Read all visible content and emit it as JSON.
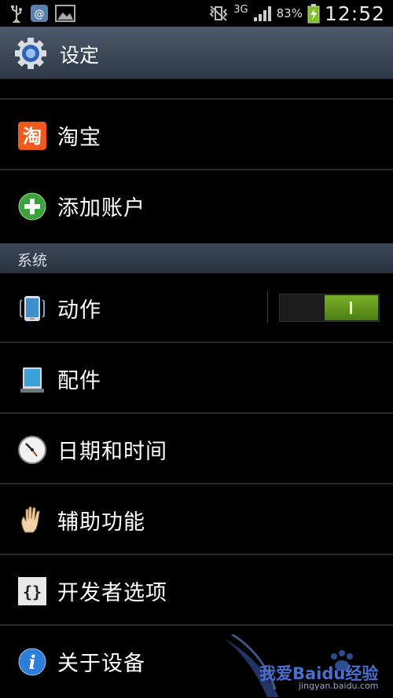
{
  "status_bar": {
    "network": "3G",
    "battery": "83%",
    "clock": "12:52"
  },
  "action_bar": {
    "title": "设定"
  },
  "accounts": [
    {
      "label": "淘宝",
      "icon": "taobao-icon"
    },
    {
      "label": "添加账户",
      "icon": "add-icon"
    }
  ],
  "section": {
    "label": "系统"
  },
  "system_items": [
    {
      "label": "动作",
      "icon": "motion-phone-icon",
      "toggle": true
    },
    {
      "label": "配件",
      "icon": "accessory-phone-icon"
    },
    {
      "label": "日期和时间",
      "icon": "clock-icon"
    },
    {
      "label": "辅助功能",
      "icon": "hand-icon"
    },
    {
      "label": "开发者选项",
      "icon": "developer-braces-icon"
    },
    {
      "label": "关于设备",
      "icon": "info-icon"
    }
  ],
  "watermark": {
    "text": "我爱Baidu经验",
    "url": "jingyan.baidu.com"
  },
  "colors": {
    "toggle_on": "#6aa223",
    "action_bar": "#3d4a5a",
    "section_header": "#323e4c"
  }
}
